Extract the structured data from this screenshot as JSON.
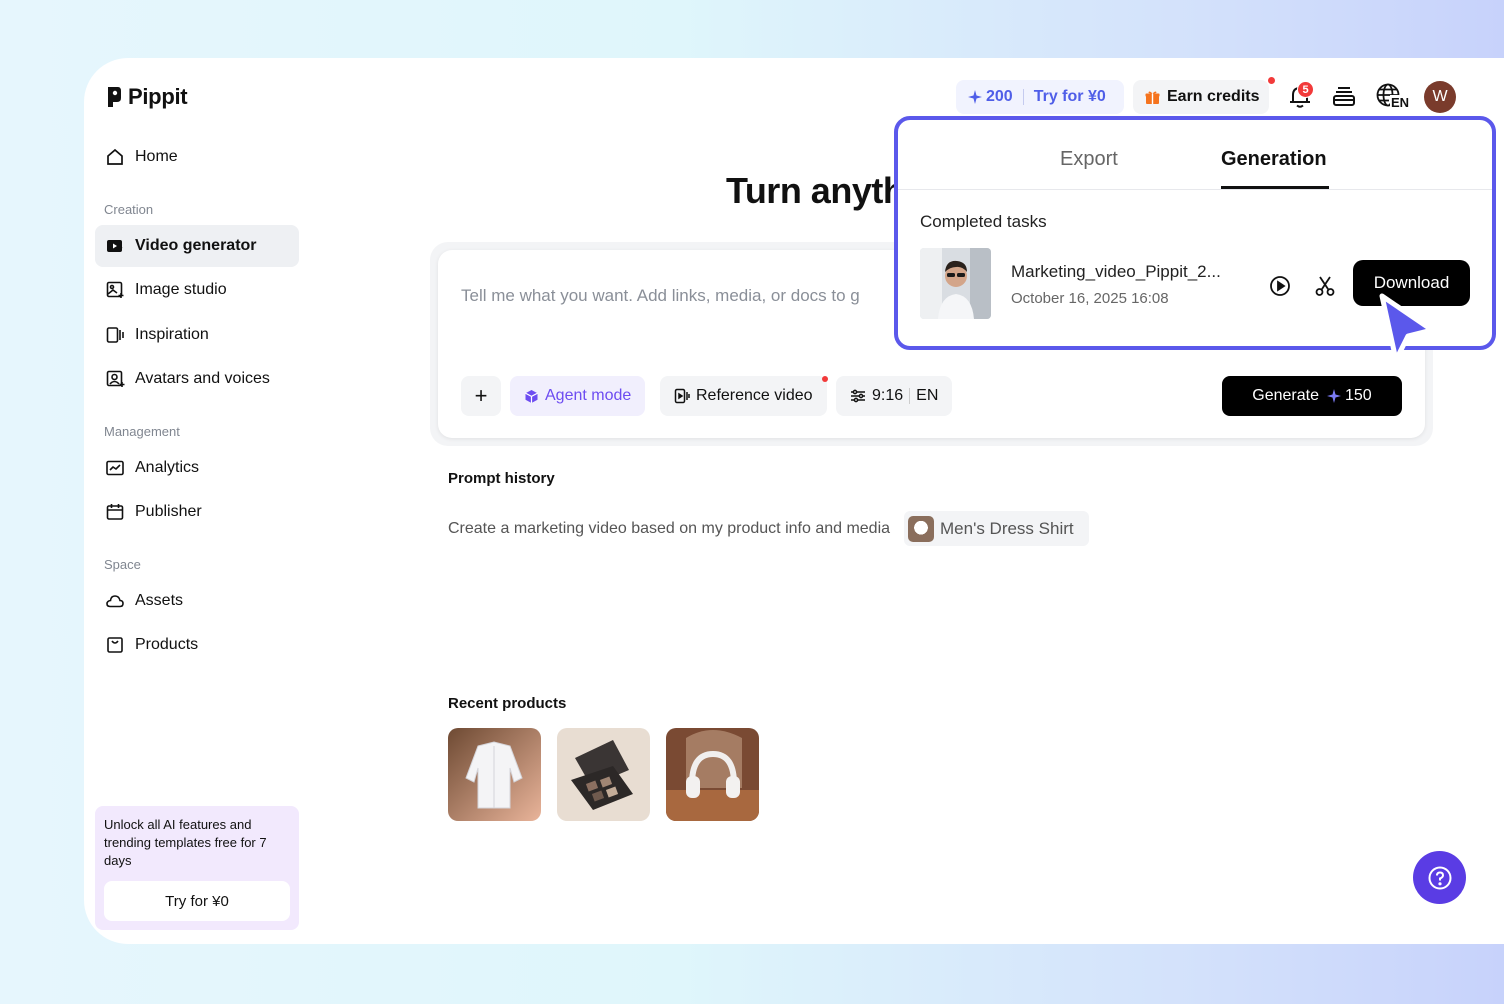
{
  "brand": {
    "name": "Pippit"
  },
  "sidebar": {
    "home": "Home",
    "sections": {
      "creation": "Creation",
      "management": "Management",
      "space": "Space"
    },
    "items": {
      "video_generator": "Video generator",
      "image_studio": "Image studio",
      "inspiration": "Inspiration",
      "avatars_voices": "Avatars and voices",
      "analytics": "Analytics",
      "publisher": "Publisher",
      "assets": "Assets",
      "products": "Products"
    },
    "active": "video_generator",
    "promo": {
      "text": "Unlock all AI features and trending templates free for 7 days",
      "button": "Try for ¥0"
    }
  },
  "topbar": {
    "credits": "200",
    "try_label": "Try for ¥0",
    "earn_label": "Earn credits",
    "notification_count": "5",
    "language": "EN",
    "avatar_letter": "W"
  },
  "main": {
    "hero_title": "Turn anyth",
    "prompt_placeholder": "Tell me what you want. Add links, media, or docs to g",
    "toolbar": {
      "add": "+",
      "agent_mode": "Agent mode",
      "reference_video": "Reference video",
      "aspect_ratio": "9:16",
      "language": "EN",
      "generate_label": "Generate",
      "generate_cost": "150"
    },
    "prompt_history": {
      "title": "Prompt history",
      "text": "Create a marketing video based on my product info and media",
      "chip_label": "Men's Dress Shirt"
    },
    "recent_products": {
      "title": "Recent products"
    }
  },
  "popup": {
    "tabs": [
      "Export",
      "Generation"
    ],
    "active_tab": "Generation",
    "section_title": "Completed tasks",
    "task": {
      "name": "Marketing_video_Pippit_2...",
      "date": "October 16, 2025 16:08",
      "download_label": "Download"
    }
  },
  "colors": {
    "accent": "#5b58eb",
    "credits_text": "#4f5ee8",
    "agent_purple": "#6d4cf1",
    "promo_bg": "#f2e9fd",
    "notification_red": "#f23a3a",
    "help_button": "#5a3ce4"
  }
}
